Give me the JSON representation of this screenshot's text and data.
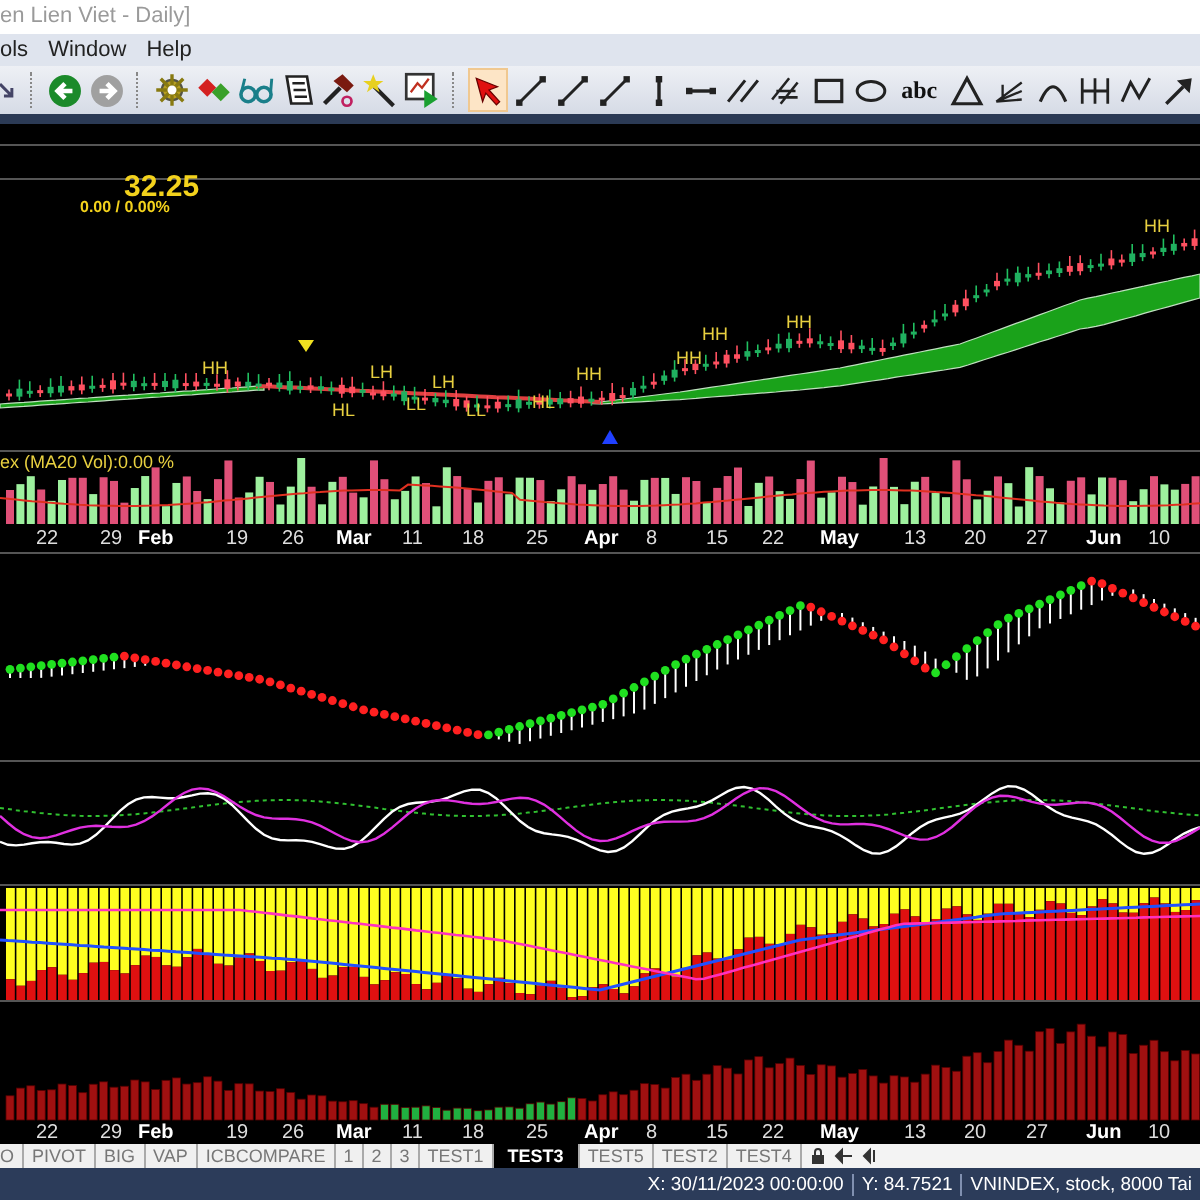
{
  "window": {
    "title": "en Lien Viet - Daily]"
  },
  "menu": [
    "ols",
    "Window",
    "Help"
  ],
  "nav_buttons": [
    {
      "kind": "back",
      "disabled": false
    },
    {
      "kind": "forward",
      "disabled": true
    }
  ],
  "tools": [
    {
      "kind": "gear"
    },
    {
      "kind": "diamonds"
    },
    {
      "kind": "glasses"
    },
    {
      "kind": "document"
    },
    {
      "kind": "hammer"
    },
    {
      "kind": "wand"
    },
    {
      "kind": "chart"
    }
  ],
  "drawing_tools": [
    {
      "kind": "pointer",
      "selected": true
    },
    {
      "kind": "segment",
      "selected": false
    },
    {
      "kind": "segment",
      "selected": false
    },
    {
      "kind": "segment",
      "selected": false
    },
    {
      "kind": "vertical",
      "selected": false
    },
    {
      "kind": "horizontal",
      "selected": false
    },
    {
      "kind": "parallel",
      "selected": false
    },
    {
      "kind": "channel",
      "selected": false
    },
    {
      "kind": "rectangle",
      "selected": false
    },
    {
      "kind": "ellipse",
      "selected": false
    },
    {
      "kind": "text",
      "label": "abc",
      "selected": false
    },
    {
      "kind": "triangle",
      "selected": false
    },
    {
      "kind": "fan",
      "selected": false
    },
    {
      "kind": "arc",
      "selected": false
    },
    {
      "kind": "cycles",
      "selected": false
    },
    {
      "kind": "zigzag",
      "selected": false
    },
    {
      "kind": "arrow",
      "selected": false
    }
  ],
  "price_panel": {
    "price": "32.25",
    "change": "0.00 / 0.00%",
    "markers": [
      {
        "text": "HH"
      },
      {
        "text": "LH"
      },
      {
        "text": "LH"
      },
      {
        "text": "HL"
      },
      {
        "text": "LL"
      },
      {
        "text": "LL"
      },
      {
        "text": "HL"
      },
      {
        "text": "HH"
      },
      {
        "text": "HH"
      },
      {
        "text": "HH"
      },
      {
        "text": "HH"
      },
      {
        "text": "HH"
      }
    ]
  },
  "volume_panel": {
    "label": "ex (MA20 Vol):0.00 %"
  },
  "date_axis_upper": [
    {
      "text": "22",
      "kind": "day"
    },
    {
      "text": "29",
      "kind": "day"
    },
    {
      "text": "Feb",
      "kind": "month"
    },
    {
      "text": "19",
      "kind": "day"
    },
    {
      "text": "26",
      "kind": "day"
    },
    {
      "text": "Mar",
      "kind": "month"
    },
    {
      "text": "11",
      "kind": "day"
    },
    {
      "text": "18",
      "kind": "day"
    },
    {
      "text": "25",
      "kind": "day"
    },
    {
      "text": "Apr",
      "kind": "month"
    },
    {
      "text": "8",
      "kind": "day"
    },
    {
      "text": "15",
      "kind": "day"
    },
    {
      "text": "22",
      "kind": "day"
    },
    {
      "text": "May",
      "kind": "month"
    },
    {
      "text": "13",
      "kind": "day"
    },
    {
      "text": "20",
      "kind": "day"
    },
    {
      "text": "27",
      "kind": "day"
    },
    {
      "text": "Jun",
      "kind": "month"
    },
    {
      "text": "10",
      "kind": "day"
    }
  ],
  "date_axis_lower": [
    {
      "text": "22",
      "kind": "day"
    },
    {
      "text": "29",
      "kind": "day"
    },
    {
      "text": "Feb",
      "kind": "month"
    },
    {
      "text": "19",
      "kind": "day"
    },
    {
      "text": "26",
      "kind": "day"
    },
    {
      "text": "Mar",
      "kind": "month"
    },
    {
      "text": "11",
      "kind": "day"
    },
    {
      "text": "18",
      "kind": "day"
    },
    {
      "text": "25",
      "kind": "day"
    },
    {
      "text": "Apr",
      "kind": "month"
    },
    {
      "text": "8",
      "kind": "day"
    },
    {
      "text": "15",
      "kind": "day"
    },
    {
      "text": "22",
      "kind": "day"
    },
    {
      "text": "May",
      "kind": "month"
    },
    {
      "text": "13",
      "kind": "day"
    },
    {
      "text": "20",
      "kind": "day"
    },
    {
      "text": "27",
      "kind": "day"
    },
    {
      "text": "Jun",
      "kind": "month"
    },
    {
      "text": "10",
      "kind": "day"
    }
  ],
  "tabs": [
    {
      "label": "O",
      "selected": false
    },
    {
      "label": "PIVOT",
      "selected": false
    },
    {
      "label": "BIG",
      "selected": false
    },
    {
      "label": "VAP",
      "selected": false
    },
    {
      "label": "ICBCOMPARE",
      "selected": false
    },
    {
      "label": "1",
      "selected": false
    },
    {
      "label": "2",
      "selected": false
    },
    {
      "label": "3",
      "selected": false
    },
    {
      "label": "TEST1",
      "selected": false
    },
    {
      "label": "TEST3",
      "selected": true
    },
    {
      "label": "TEST5",
      "selected": false
    },
    {
      "label": "TEST2",
      "selected": false
    },
    {
      "label": "TEST4",
      "selected": false
    }
  ],
  "status_bar": [
    "X: 30/11/2023 00:00:00",
    "Y: 84.7521",
    "VNINDEX, stock, 8000 Tai"
  ]
}
